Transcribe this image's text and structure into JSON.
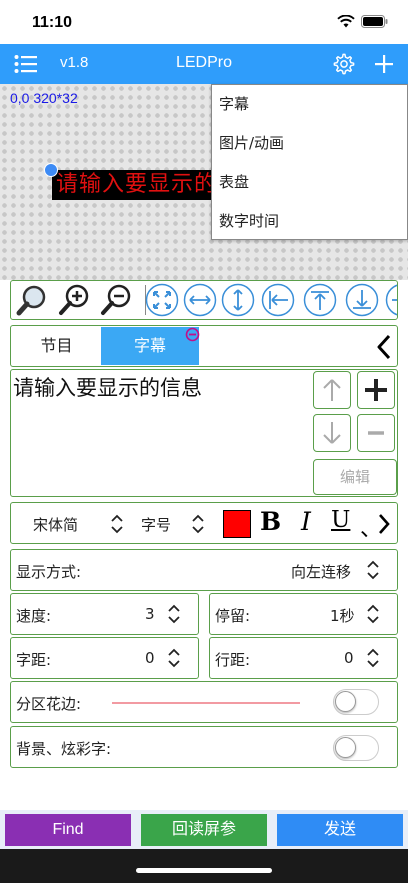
{
  "status": {
    "time": "11:10"
  },
  "nav": {
    "version": "v1.8",
    "title": "LEDPro"
  },
  "canvas": {
    "coords": "0,0 320*32",
    "preview_text": "请输入要显示的信息"
  },
  "dropdown": {
    "items": [
      "字幕",
      "图片/动画",
      "表盘",
      "数字时间"
    ]
  },
  "tabs": {
    "program": "节目",
    "subtitle": "字幕"
  },
  "editor": {
    "text": "请输入要显示的信息",
    "edit_label": "编辑"
  },
  "font": {
    "name": "宋体简",
    "size_label": "字号",
    "color": "#ff0000",
    "bold": "B",
    "italic": "I",
    "underline": "U",
    "sep": "、"
  },
  "display_mode": {
    "label": "显示方式:",
    "value": "向左连移"
  },
  "speed": {
    "label": "速度:",
    "value": "3"
  },
  "stay": {
    "label": "停留:",
    "value": "1秒"
  },
  "char_spacing": {
    "label": "字距:",
    "value": "0"
  },
  "line_spacing": {
    "label": "行距:",
    "value": "0"
  },
  "partition_border": {
    "label": "分区花边:",
    "enabled": false
  },
  "background": {
    "label": "背景、炫彩字:",
    "enabled": false
  },
  "bottom": {
    "find": "Find",
    "read_back": "回读屏参",
    "send": "发送"
  },
  "colors": {
    "accent": "#2f9dfb",
    "tab_active": "#3ba8f4",
    "find": "#8a2fb3",
    "read_back": "#3aa54a",
    "send": "#2f8cf5",
    "frame": "#5a9e4a"
  }
}
